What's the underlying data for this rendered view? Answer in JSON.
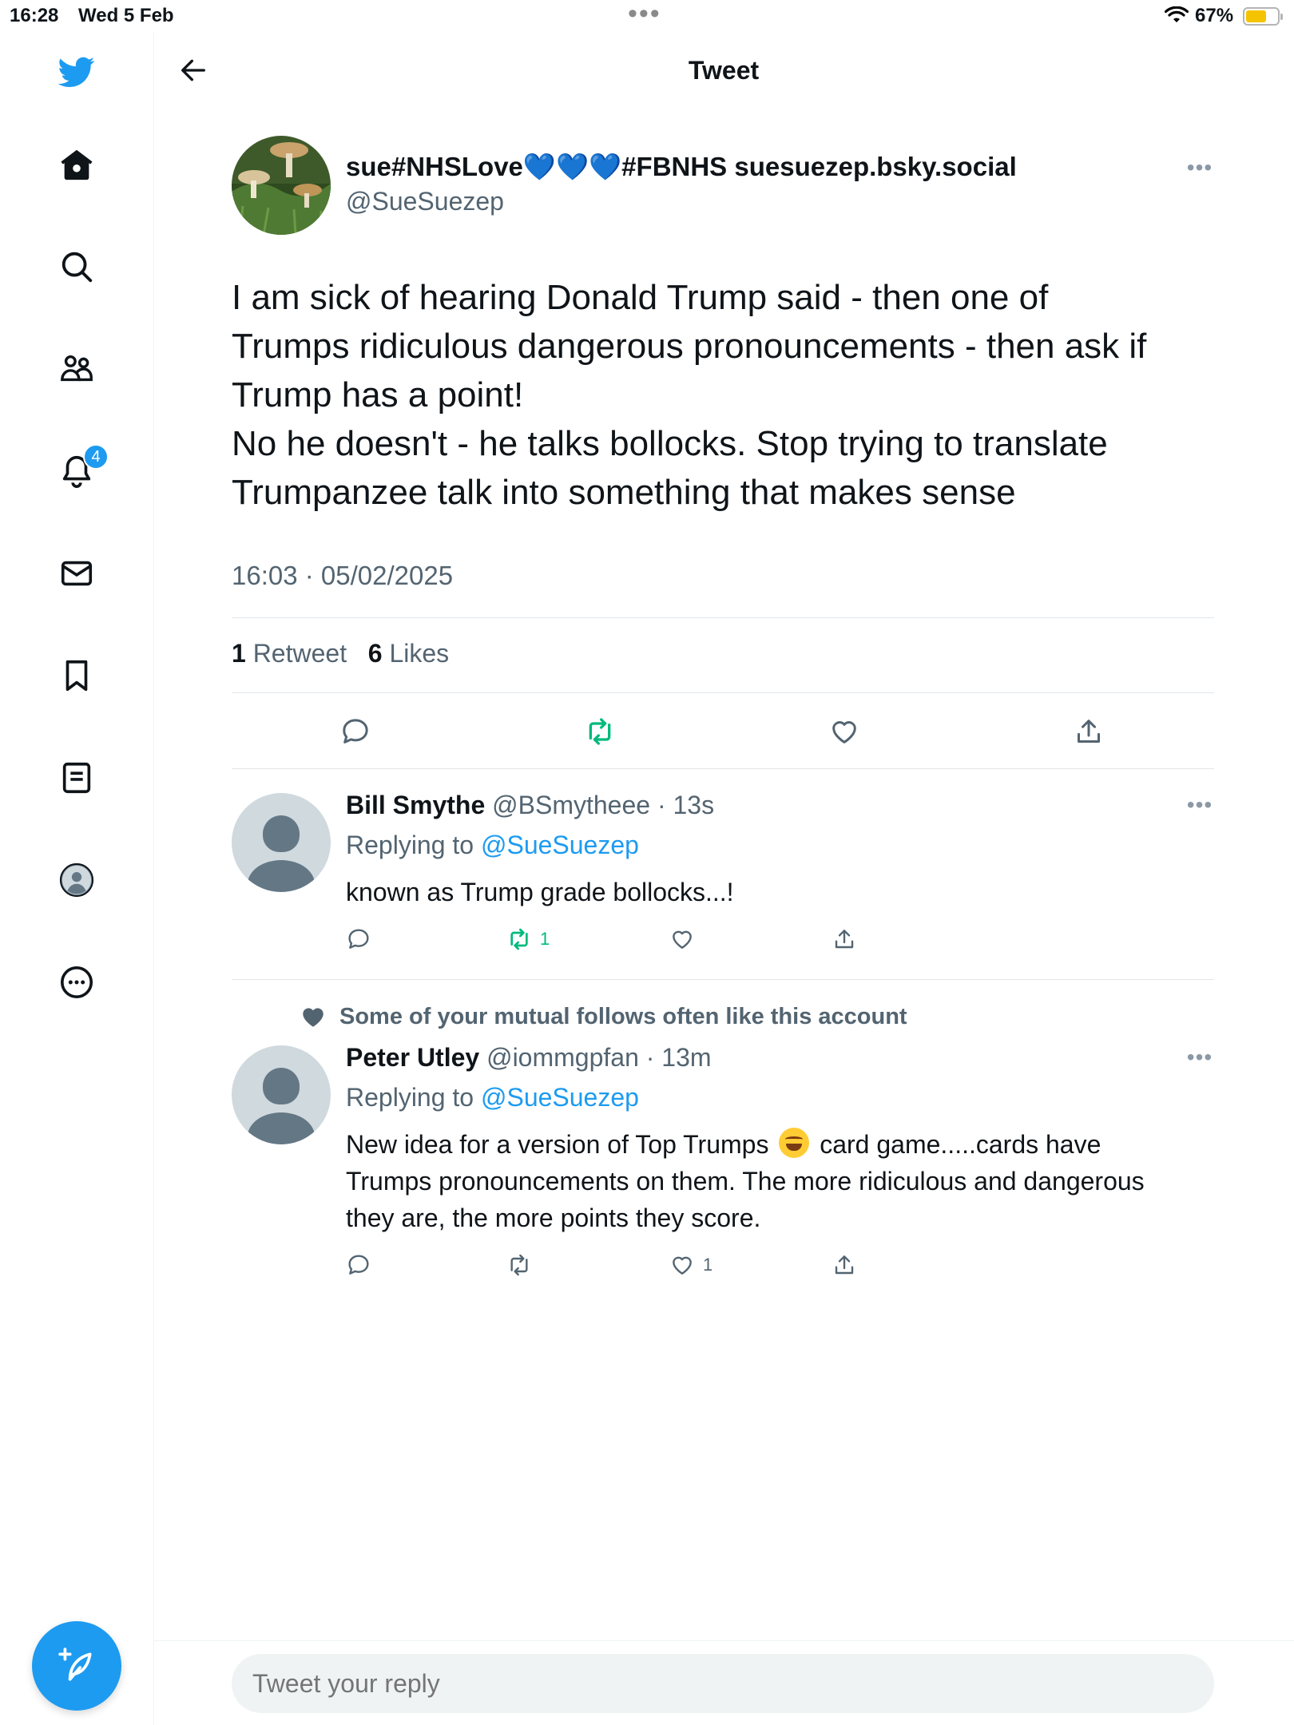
{
  "status_bar": {
    "time": "16:28",
    "date": "Wed 5 Feb",
    "battery_percent": "67%",
    "battery_level": 0.67,
    "colors": {
      "battery_fill": "#f5c400"
    }
  },
  "sidebar": {
    "items": [
      {
        "icon": "twitter-bird-icon"
      },
      {
        "icon": "home-icon"
      },
      {
        "icon": "search-icon"
      },
      {
        "icon": "communities-icon"
      },
      {
        "icon": "notifications-icon",
        "badge": "4"
      },
      {
        "icon": "messages-icon"
      },
      {
        "icon": "bookmark-icon"
      },
      {
        "icon": "lists-icon"
      },
      {
        "icon": "profile-icon"
      },
      {
        "icon": "more-icon"
      }
    ],
    "compose_icon": "compose-tweet-icon"
  },
  "header": {
    "title": "Tweet",
    "back_icon": "arrow-left-icon"
  },
  "tweet": {
    "display_name": "sue#NHSLove💙💙💙#FBNHS suesuezep.bsky.social",
    "handle": "@SueSuezep",
    "text_lines": [
      "I am sick of hearing Donald Trump said - then one of",
      "Trumps ridiculous dangerous pronouncements - then ask if",
      "Trump has a point!",
      "No he doesn't - he talks bollocks. Stop trying to translate",
      "Trumpanzee talk into something that makes sense"
    ],
    "timestamp": "16:03 · 05/02/2025",
    "retweet_count": "1",
    "retweet_label": "Retweet",
    "like_count": "6",
    "like_label": "Likes"
  },
  "replies": [
    {
      "name": "Bill Smythe",
      "handle": "@BSmytheee",
      "time": "· 13s",
      "replying_label": "Replying to",
      "replying_to": "@SueSuezep",
      "text_lines": [
        "known as Trump grade bollocks...!"
      ],
      "retweets": "1",
      "likes": ""
    },
    {
      "social_context": "Some of your mutual follows often like this account",
      "name": "Peter Utley",
      "handle": "@iommgpfan",
      "time": "· 13m",
      "replying_label": "Replying to",
      "replying_to": "@SueSuezep",
      "text_line1_before": "New idea for a version of Top Trumps",
      "text_line1_after": "card game.....cards have",
      "text_lines": [
        "Trumps pronouncements on them. The more ridiculous and dangerous",
        "they are, the more points they score."
      ],
      "retweets": "",
      "likes": "1"
    }
  ],
  "composer": {
    "placeholder": "Tweet your reply"
  },
  "colors": {
    "accent": "#1d9bf0",
    "retweet_active": "#00ba7c",
    "secondary_text": "#536471"
  }
}
